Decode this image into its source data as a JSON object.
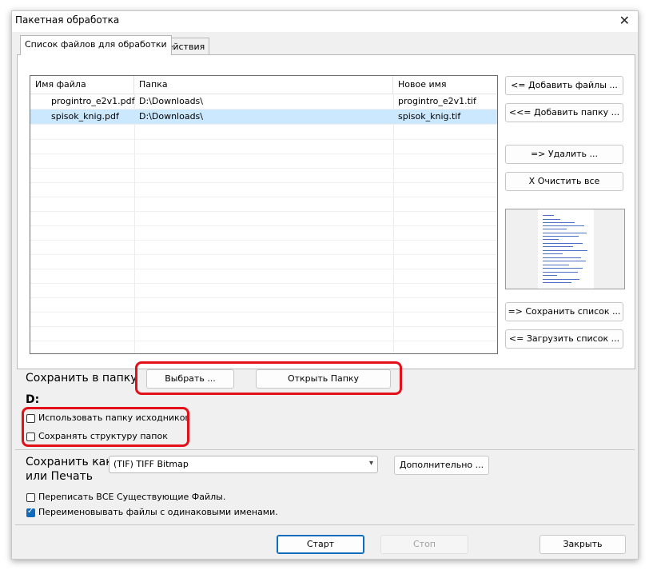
{
  "window": {
    "title": "Пакетная обработка",
    "close_glyph": "✕"
  },
  "tabs": [
    {
      "label": "Список файлов для обработки",
      "active": true
    },
    {
      "label": "Действия",
      "active": false
    }
  ],
  "file_list": {
    "columns": [
      "Имя файла",
      "Папка",
      "Новое имя"
    ],
    "rows": [
      {
        "name": "progintro_e2v1.pdf",
        "folder": "D:\\Downloads\\",
        "new_name": "progintro_e2v1.tif",
        "selected": false
      },
      {
        "name": "spisok_knig.pdf",
        "folder": "D:\\Downloads\\",
        "new_name": "spisok_knig.tif",
        "selected": true
      }
    ]
  },
  "side_buttons": {
    "add_files": "<= Добавить файлы ...",
    "add_folder": "<<= Добавить папку ...",
    "delete": "=> Удалить ...",
    "clear_all": "X Очистить все",
    "save_list": "=> Сохранить список ...",
    "load_list": "<= Загрузить список ..."
  },
  "save_folder": {
    "label": "Сохранить в папку",
    "choose_button": "Выбрать ...",
    "open_button": "Открыть Папку",
    "path": "D:",
    "use_source_folder": {
      "label": "Использовать папку исходников",
      "checked": false
    },
    "keep_structure": {
      "label": "Сохранять структуру папок",
      "checked": false
    }
  },
  "save_as": {
    "label_line1": "Сохранить как",
    "label_line2": "или Печать",
    "format_value": "(TIF) TIFF Bitmap",
    "advanced_button": "Дополнительно ...",
    "overwrite": {
      "label": "Переписать ВСЕ Существующие Файлы.",
      "checked": false
    },
    "rename_duplicates": {
      "label": "Переименовывать файлы с одинаковыми именами.",
      "checked": true
    }
  },
  "footer": {
    "start": "Старт",
    "stop": "Стоп",
    "close": "Закрыть"
  },
  "colors": {
    "highlight": "#e3101a",
    "selection": "#cce8ff",
    "accent": "#0f6cbd"
  }
}
